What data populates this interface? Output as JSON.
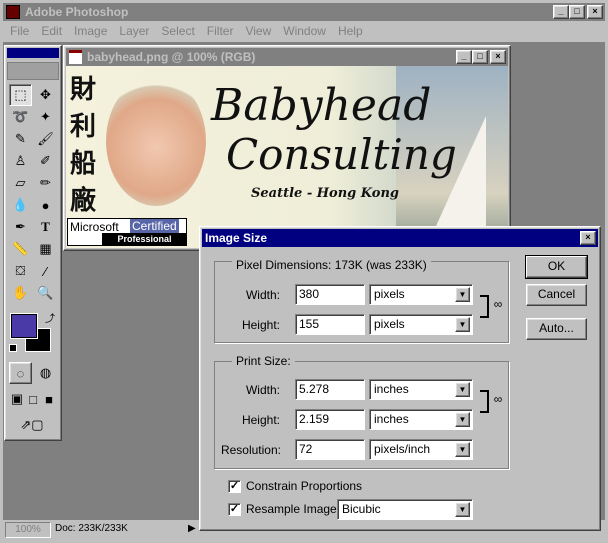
{
  "app": {
    "title": "Adobe Photoshop",
    "title_bar_color": "#808080"
  },
  "menu": [
    "File",
    "Edit",
    "Image",
    "Layer",
    "Select",
    "Filter",
    "View",
    "Window",
    "Help"
  ],
  "document": {
    "title": "babyhead.png @ 100% (RGB)",
    "image": {
      "chinese": "財利船廠",
      "headline1": "Babyhead",
      "headline2": "Consulting",
      "tagline": "Seattle - Hong Kong",
      "badge_ms": "Microsoft",
      "badge_cert": "Certified",
      "badge_pro": "Professional"
    }
  },
  "status": {
    "zoom": "100%",
    "doc": "Doc: 233K/233K"
  },
  "toolbox": {
    "foreground_color": "#4a3aa8",
    "background_color": "#000000"
  },
  "dialog": {
    "title": "Image Size",
    "title_bar_color": "#000080",
    "pixel_dimensions": {
      "label": "Pixel Dimensions:  173K (was 233K)",
      "width_label": "Width:",
      "width_value": "380",
      "width_unit": "pixels",
      "height_label": "Height:",
      "height_value": "155",
      "height_unit": "pixels"
    },
    "print_size": {
      "label": "Print Size:",
      "width_label": "Width:",
      "width_value": "5.278",
      "width_unit": "inches",
      "height_label": "Height:",
      "height_value": "2.159",
      "height_unit": "inches",
      "resolution_label": "Resolution:",
      "resolution_value": "72",
      "resolution_unit": "pixels/inch"
    },
    "constrain": {
      "label": "Constrain Proportions",
      "checked": true
    },
    "resample": {
      "label": "Resample Image:",
      "checked": true,
      "value": "Bicubic"
    },
    "buttons": {
      "ok": "OK",
      "cancel": "Cancel",
      "auto": "Auto..."
    }
  }
}
